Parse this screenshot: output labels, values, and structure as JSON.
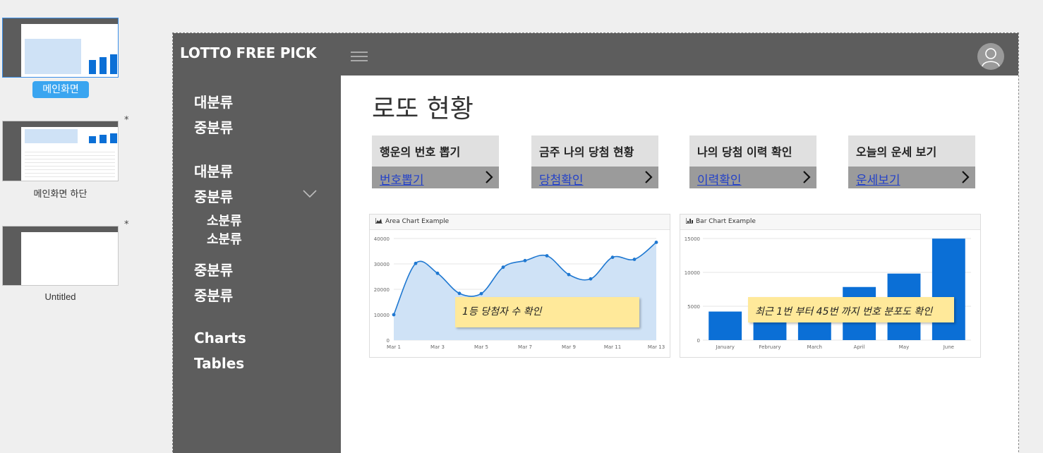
{
  "pages": [
    {
      "label": "메인화면",
      "selected": true,
      "modified": false
    },
    {
      "label": "메인화면 하단",
      "selected": false,
      "modified": true
    },
    {
      "label": "Untitled",
      "selected": false,
      "modified": true
    }
  ],
  "modified_marker": "*",
  "app": {
    "brand": "LOTTO FREE PICK",
    "menu_icon": "hamburger-icon",
    "avatar_icon": "user-icon"
  },
  "sidebar": {
    "items": [
      {
        "label": "대분류"
      },
      {
        "label": "중분류"
      },
      {
        "label": "대분류"
      },
      {
        "label": "중분류"
      },
      {
        "label": "소분류"
      },
      {
        "label": "소분류"
      },
      {
        "label": "중분류"
      },
      {
        "label": "중분류"
      },
      {
        "label": "Charts"
      },
      {
        "label": "Tables"
      }
    ]
  },
  "main": {
    "title": "로또 현황",
    "cards": [
      {
        "title": "행운의 번호 뽑기",
        "link": "번호뽑기"
      },
      {
        "title": "금주 나의 당첨 현황",
        "link": "당첨확인"
      },
      {
        "title": "나의 당첨 이력 확인",
        "link": "이력확인"
      },
      {
        "title": "오늘의 운세 보기",
        "link": "운세보기"
      }
    ],
    "notes": {
      "area": "1등 당첨자 수 확인",
      "bar": "최근 1번 부터 45번 까지  번호 분포도 확인"
    }
  },
  "chart_data": [
    {
      "type": "area",
      "title": "Area Chart Example",
      "x": [
        "Mar 1",
        "Mar 2",
        "Mar 3",
        "Mar 4",
        "Mar 5",
        "Mar 6",
        "Mar 7",
        "Mar 8",
        "Mar 9",
        "Mar 10",
        "Mar 11",
        "Mar 12",
        "Mar 13"
      ],
      "x_tick_labels": [
        "Mar 1",
        "Mar 3",
        "Mar 5",
        "Mar 7",
        "Mar 9",
        "Mar 11",
        "Mar 13"
      ],
      "values": [
        10000,
        30200,
        26300,
        18400,
        18300,
        28700,
        31300,
        33200,
        25800,
        24100,
        32600,
        31800,
        38500
      ],
      "ylim": [
        0,
        40000
      ],
      "y_ticks": [
        0,
        10000,
        20000,
        30000,
        40000
      ],
      "grid": true,
      "color": "#1f78d1",
      "fill": "#cfe2f6"
    },
    {
      "type": "bar",
      "title": "Bar Chart Example",
      "categories": [
        "January",
        "February",
        "March",
        "April",
        "May",
        "June"
      ],
      "values": [
        4215,
        5312,
        6251,
        7841,
        9821,
        14984
      ],
      "ylim": [
        0,
        15000
      ],
      "y_ticks": [
        0,
        5000,
        10000,
        15000
      ],
      "grid": true,
      "color": "#0b6fd6"
    }
  ],
  "colors": {
    "sidebar": "#5d5d5d",
    "accent": "#3aa5f0",
    "link": "#2442c8",
    "note": "#ffe99a"
  }
}
